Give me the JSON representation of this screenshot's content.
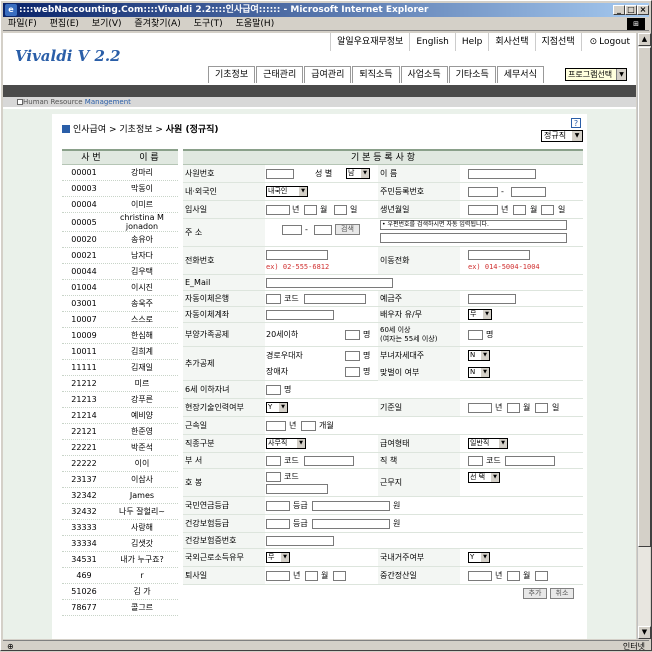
{
  "window": {
    "title": "::::webNaccounting.Com::::Vivaldi 2.2::::인사급여:::::: - Microsoft Internet Explorer",
    "min": "_",
    "max": "□",
    "close": "×"
  },
  "menu": [
    "파일(F)",
    "편집(E)",
    "보기(V)",
    "즐겨찾기(A)",
    "도구(T)",
    "도움말(H)"
  ],
  "status": {
    "done": "⊕",
    "zone": "인터넷"
  },
  "topnav": [
    "알일우요재무정보",
    "English",
    "Help",
    "회사선택",
    "지점선택",
    "Logout"
  ],
  "logo": "Vivaldi  V 2.2",
  "mainnav": [
    "기초정보",
    "근태관리",
    "급여관리",
    "퇴직소득",
    "사업소득",
    "기타소득",
    "세무서식"
  ],
  "program_select": "프로그램선택",
  "subheader": {
    "a": "Human Resource ",
    "b": "Management"
  },
  "breadcrumb": {
    "a": "인사급여 > 기초정보 > ",
    "b": "사원 (정규직)"
  },
  "help": "?",
  "status_select": "정규직",
  "list": {
    "col_code": "사 번",
    "col_name": "이 름",
    "rows": [
      {
        "c": "00001",
        "n": "강마리"
      },
      {
        "c": "00003",
        "n": "막동이"
      },
      {
        "c": "00004",
        "n": "이미르"
      },
      {
        "c": "00005",
        "n": "christina M jonadon"
      },
      {
        "c": "00020",
        "n": "송유아"
      },
      {
        "c": "00021",
        "n": "남자다"
      },
      {
        "c": "00044",
        "n": "김우택"
      },
      {
        "c": "01004",
        "n": "이시진"
      },
      {
        "c": "03001",
        "n": "송욱주"
      },
      {
        "c": "10007",
        "n": "스스로"
      },
      {
        "c": "10009",
        "n": "한심해"
      },
      {
        "c": "10011",
        "n": "김희계"
      },
      {
        "c": "11111",
        "n": "김재일"
      },
      {
        "c": "21212",
        "n": "미르"
      },
      {
        "c": "21213",
        "n": "강푸른"
      },
      {
        "c": "21214",
        "n": "예비양"
      },
      {
        "c": "22121",
        "n": "한준영"
      },
      {
        "c": "22221",
        "n": "박준석"
      },
      {
        "c": "22222",
        "n": "이이"
      },
      {
        "c": "23137",
        "n": "이삼사"
      },
      {
        "c": "32342",
        "n": "James"
      },
      {
        "c": "32432",
        "n": "나두 잘헐리~"
      },
      {
        "c": "33333",
        "n": "사랑해"
      },
      {
        "c": "33334",
        "n": "김샛갓"
      },
      {
        "c": "34531",
        "n": "내가 누구죠?"
      },
      {
        "c": "469",
        "n": "r"
      },
      {
        "c": "51026",
        "n": "김 가"
      },
      {
        "c": "78677",
        "n": "콜그르"
      }
    ]
  },
  "form": {
    "title": "기 본 등 록 사 항",
    "emp_no": "사원번호",
    "gender": "성 별",
    "gender_val": "남",
    "name": "이 름",
    "nationality": "내·외국인",
    "nationality_val": "내국인",
    "rrn": "주민등록번호",
    "dash": "-",
    "hire": "입사일",
    "year": "년",
    "month": "월",
    "day": "일",
    "birth": "생년월일",
    "address": "주 소",
    "search": "검색",
    "addr_hint": "• 우편번호를 검색하시면 자동 입력됩니다.",
    "phone": "전화번호",
    "phone_ex": "ex) 02-555-6812",
    "mobile": "이동전화",
    "mobile_ex": "ex) 014-5004-1004",
    "email": "E_Mail",
    "bank": "자동이체은행",
    "code": "코드",
    "depositor": "예금주",
    "account": "자동이체계좌",
    "spouse": "배우자 유/무",
    "spouse_val": "무",
    "dependents": "부양가족공제",
    "under20": "20세이하",
    "persons": "명",
    "over60": "60세 이상\n(여자는 55세 이상)",
    "extra": "추가공제",
    "elderly": "경로우대자",
    "disabled": "장애자",
    "female_head": "부녀자세대주",
    "fh_val": "N",
    "dual": "맞벌이 여부",
    "dual_val": "N",
    "under6": "6세 이하자녀",
    "tech": "현장기술인력여부",
    "tech_val": "Y",
    "base_date": "기준일",
    "service": "근속일",
    "month2": "개월",
    "job_class": "직종구분",
    "job_class_val": "사무직",
    "pay_type": "급여형태",
    "pay_type_val": "일반직",
    "dept": "부 서",
    "position": "직 책",
    "rank": "호 봉",
    "workplace": "근무지",
    "workplace_val": "선 택",
    "pension": "국민연금등급",
    "grade": "등급",
    "won": "원",
    "health": "건강보험등급",
    "health_no": "건강보험증번호",
    "domestic_tax": "국외근로소득유무",
    "domestic_tax_val": "무",
    "resident": "국내거주여부",
    "resident_val": "Y",
    "resign": "퇴사일",
    "mid_settle": "중간정산일",
    "add_btn": "추가",
    "cancel_btn": "취소"
  }
}
